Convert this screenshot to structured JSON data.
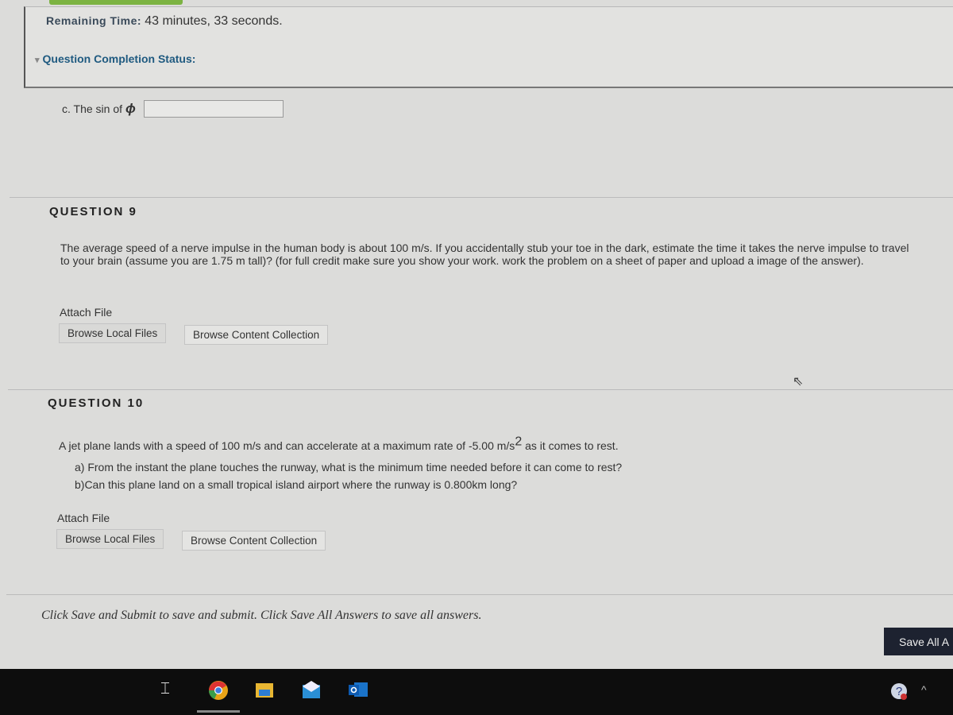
{
  "header": {
    "remaining_time_label": "Remaining Time:",
    "remaining_time_value": "43 minutes, 33 seconds.",
    "completion_status": "Question Completion Status:"
  },
  "prev_question": {
    "part_c_label": "c. The sin of",
    "phi_symbol": "ϕ",
    "part_c_value": ""
  },
  "questions": [
    {
      "title": "QUESTION 9",
      "text": "The average speed of a nerve impulse in the human body is about 100 m/s. If you accidentally stub your toe in the dark, estimate the time it takes the nerve impulse to travel to your brain (assume you are 1.75 m tall)? (for full credit make sure you show your work. work the problem on a sheet of paper and upload a image of the answer).",
      "attach_label": "Attach File",
      "browse_local": "Browse Local Files",
      "browse_collection": "Browse Content Collection"
    },
    {
      "title": "QUESTION 10",
      "text_pre": "A jet plane lands with a speed of 100 m/s and can accelerate at a maximum rate of -5.00 m/s",
      "text_sup": "2",
      "text_post": " as it comes to rest.",
      "part_a": "a) From the instant the plane touches the runway, what is the minimum time needed before it can come to rest?",
      "part_b": "b)Can this plane land on a small tropical island airport where the runway is 0.800km long?",
      "attach_label": "Attach File",
      "browse_local": "Browse Local Files",
      "browse_collection": "Browse Content Collection"
    }
  ],
  "footer": {
    "note": "Click Save and Submit to save and submit. Click Save All Answers to save all answers.",
    "save_all": "Save All A"
  },
  "taskbar": {
    "icons": [
      "task-view-icon",
      "chrome-icon",
      "file-explorer-icon",
      "mail-icon",
      "outlook-icon",
      "help-icon",
      "chevron-up-icon"
    ]
  },
  "colors": {
    "progress": "#7cb342",
    "status_link": "#1f5a80",
    "save_button": "#1d2230",
    "taskbar": "#0d0d0d"
  }
}
